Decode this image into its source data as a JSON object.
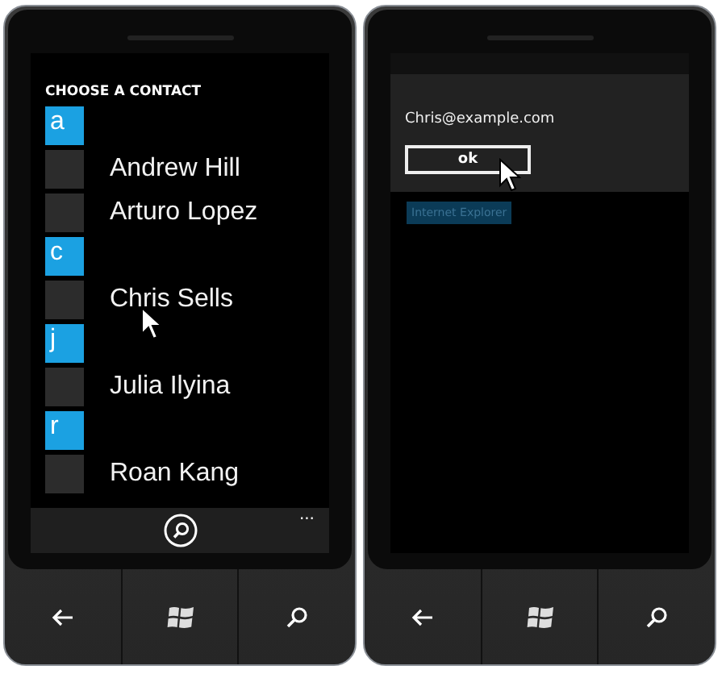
{
  "phones": [
    {
      "kind": "contacts",
      "title": "CHOOSE A CONTACT",
      "groups": [
        {
          "letter": "a",
          "contacts": [
            "Andrew Hill",
            "Arturo Lopez"
          ]
        },
        {
          "letter": "c",
          "contacts": [
            "Chris Sells"
          ]
        },
        {
          "letter": "j",
          "contacts": [
            "Julia Ilyina"
          ]
        },
        {
          "letter": "r",
          "contacts": [
            "Roan Kang"
          ]
        }
      ],
      "app_bar": {
        "more": "..."
      }
    },
    {
      "kind": "dialog",
      "message": "Chris@example.com",
      "button": "ok",
      "tooltip": "Internet Explorer"
    }
  ]
}
